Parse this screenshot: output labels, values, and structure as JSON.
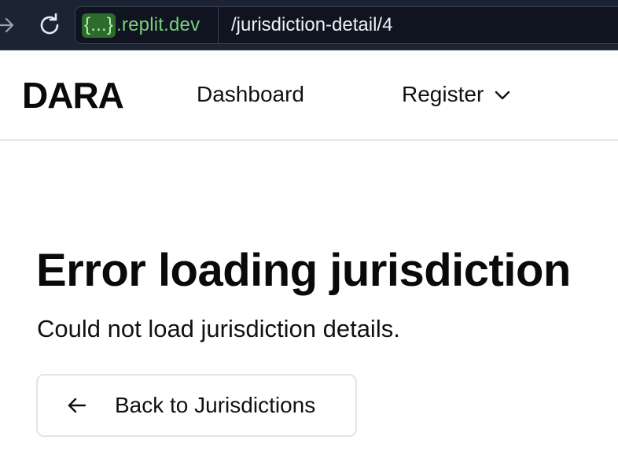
{
  "browser": {
    "url_badge": "{...}",
    "url_host_suffix": ".replit.dev",
    "url_path": "/jurisdiction-detail/4",
    "icons": {
      "forward": "arrow-right-icon",
      "reload": "reload-icon"
    },
    "colors": {
      "toolbar_bg": "#1c2333",
      "host_text": "#7ccf7c",
      "badge_bg": "#2d6a2d"
    }
  },
  "header": {
    "brand": "DARA",
    "nav": {
      "dashboard_label": "Dashboard",
      "register_label": "Register",
      "register_icon": "chevron-down-icon"
    }
  },
  "main": {
    "error_title": "Error loading jurisdiction",
    "error_message": "Could not load jurisdiction details.",
    "back_button": {
      "label": "Back to Jurisdictions",
      "icon": "arrow-left-icon"
    }
  }
}
